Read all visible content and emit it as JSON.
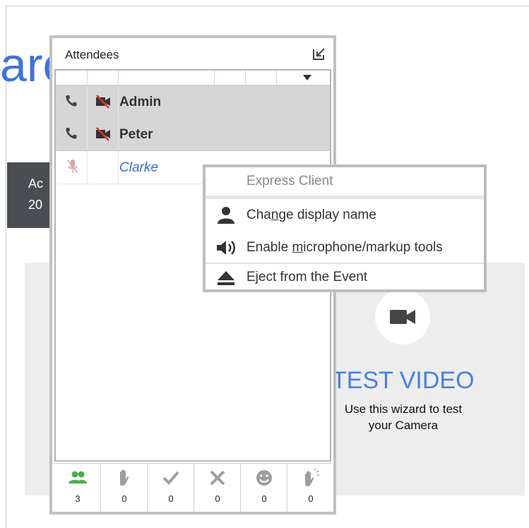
{
  "background": {
    "title_fragment": "arc",
    "dark_box_lines": [
      "Ac",
      "20"
    ],
    "test_video": {
      "title": "TEST VIDEO",
      "description_line1": "Use this wizard to test",
      "description_line2": "your Camera"
    }
  },
  "attendees": {
    "title": "Attendees",
    "rows": [
      {
        "name": "Admin",
        "selected": true
      },
      {
        "name": "Peter",
        "selected": true
      },
      {
        "name": "Clarke",
        "selected": false
      }
    ],
    "stats": [
      {
        "icon": "people-icon",
        "count": "3",
        "color": "#4caf50"
      },
      {
        "icon": "raise-hand-icon",
        "count": "0"
      },
      {
        "icon": "checkmark-icon",
        "count": "0"
      },
      {
        "icon": "x-icon",
        "count": "0"
      },
      {
        "icon": "smiley-icon",
        "count": "0"
      },
      {
        "icon": "applause-icon",
        "count": "0"
      }
    ]
  },
  "context_menu": {
    "header": "Express Client",
    "items": [
      {
        "label_pre": "Cha",
        "label_u": "n",
        "label_post": "ge display name",
        "icon": "person-icon"
      },
      {
        "label_pre": "Enable ",
        "label_u": "m",
        "label_post": "icrophone/markup tools",
        "icon": "speaker-icon"
      },
      {
        "label_pre": "E",
        "label_u": "j",
        "label_post": "ect from the Event",
        "icon": "eject-icon"
      }
    ]
  },
  "colors": {
    "accent_blue": "#3f73d8",
    "muted_red": "#d9342b",
    "green": "#4caf50"
  }
}
